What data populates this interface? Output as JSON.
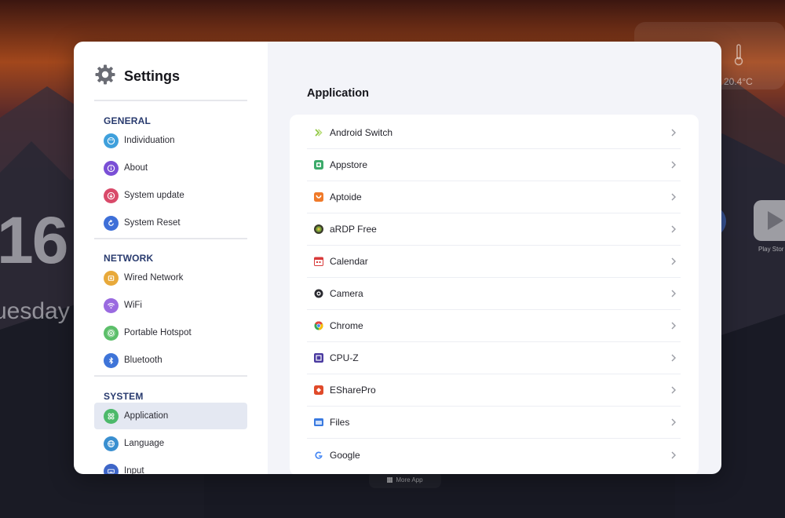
{
  "background": {
    "temperature": "20.4°C",
    "clock_partial": "16",
    "day_partial": "uesday",
    "app_label_partial": "Play Stor",
    "dock_label": "More App"
  },
  "sidebar": {
    "title": "Settings",
    "sections": [
      {
        "label": "GENERAL",
        "items": [
          {
            "label": "Individuation",
            "icon": "palette-icon",
            "color": "#3fa0dc"
          },
          {
            "label": "About",
            "icon": "info-icon",
            "color": "#7a4fd6"
          },
          {
            "label": "System update",
            "icon": "update-icon",
            "color": "#d94a6a"
          },
          {
            "label": "System Reset",
            "icon": "reset-icon",
            "color": "#3e6fd8"
          }
        ]
      },
      {
        "label": "NETWORK",
        "items": [
          {
            "label": "Wired Network",
            "icon": "ethernet-icon",
            "color": "#e8a93a"
          },
          {
            "label": "WiFi",
            "icon": "wifi-icon",
            "color": "#9a6ae0"
          },
          {
            "label": "Portable Hotspot",
            "icon": "hotspot-icon",
            "color": "#5cbf6a"
          },
          {
            "label": "Bluetooth",
            "icon": "bluetooth-icon",
            "color": "#3e74d8"
          }
        ]
      },
      {
        "label": "SYSTEM",
        "items": [
          {
            "label": "Application",
            "icon": "apps-icon",
            "color": "#4cb96a",
            "active": true
          },
          {
            "label": "Language",
            "icon": "globe-icon",
            "color": "#3a8fd0"
          },
          {
            "label": "Input",
            "icon": "keyboard-icon",
            "color": "#3e66c8"
          }
        ]
      }
    ]
  },
  "content": {
    "title": "Application",
    "apps": [
      {
        "name": "Android Switch",
        "icon": "android-switch-icon",
        "color": "#8dc63f"
      },
      {
        "name": "Appstore",
        "icon": "appstore-icon",
        "color": "#3caa6a"
      },
      {
        "name": "Aptoide",
        "icon": "aptoide-icon",
        "color": "#f07a2a"
      },
      {
        "name": "aRDP Free",
        "icon": "ardp-icon",
        "color": "#6a8a3a"
      },
      {
        "name": "Calendar",
        "icon": "calendar-icon",
        "color": "#d83a3a"
      },
      {
        "name": "Camera",
        "icon": "camera-icon",
        "color": "#2a2a30"
      },
      {
        "name": "Chrome",
        "icon": "chrome-icon",
        "color": "#e8453c"
      },
      {
        "name": "CPU-Z",
        "icon": "cpuz-icon",
        "color": "#4a3aa0"
      },
      {
        "name": "ESharePro",
        "icon": "esharepro-icon",
        "color": "#e04a2a"
      },
      {
        "name": "Files",
        "icon": "files-icon",
        "color": "#3a7ae0"
      },
      {
        "name": "Google",
        "icon": "google-icon",
        "color": "#4285f4"
      }
    ]
  }
}
